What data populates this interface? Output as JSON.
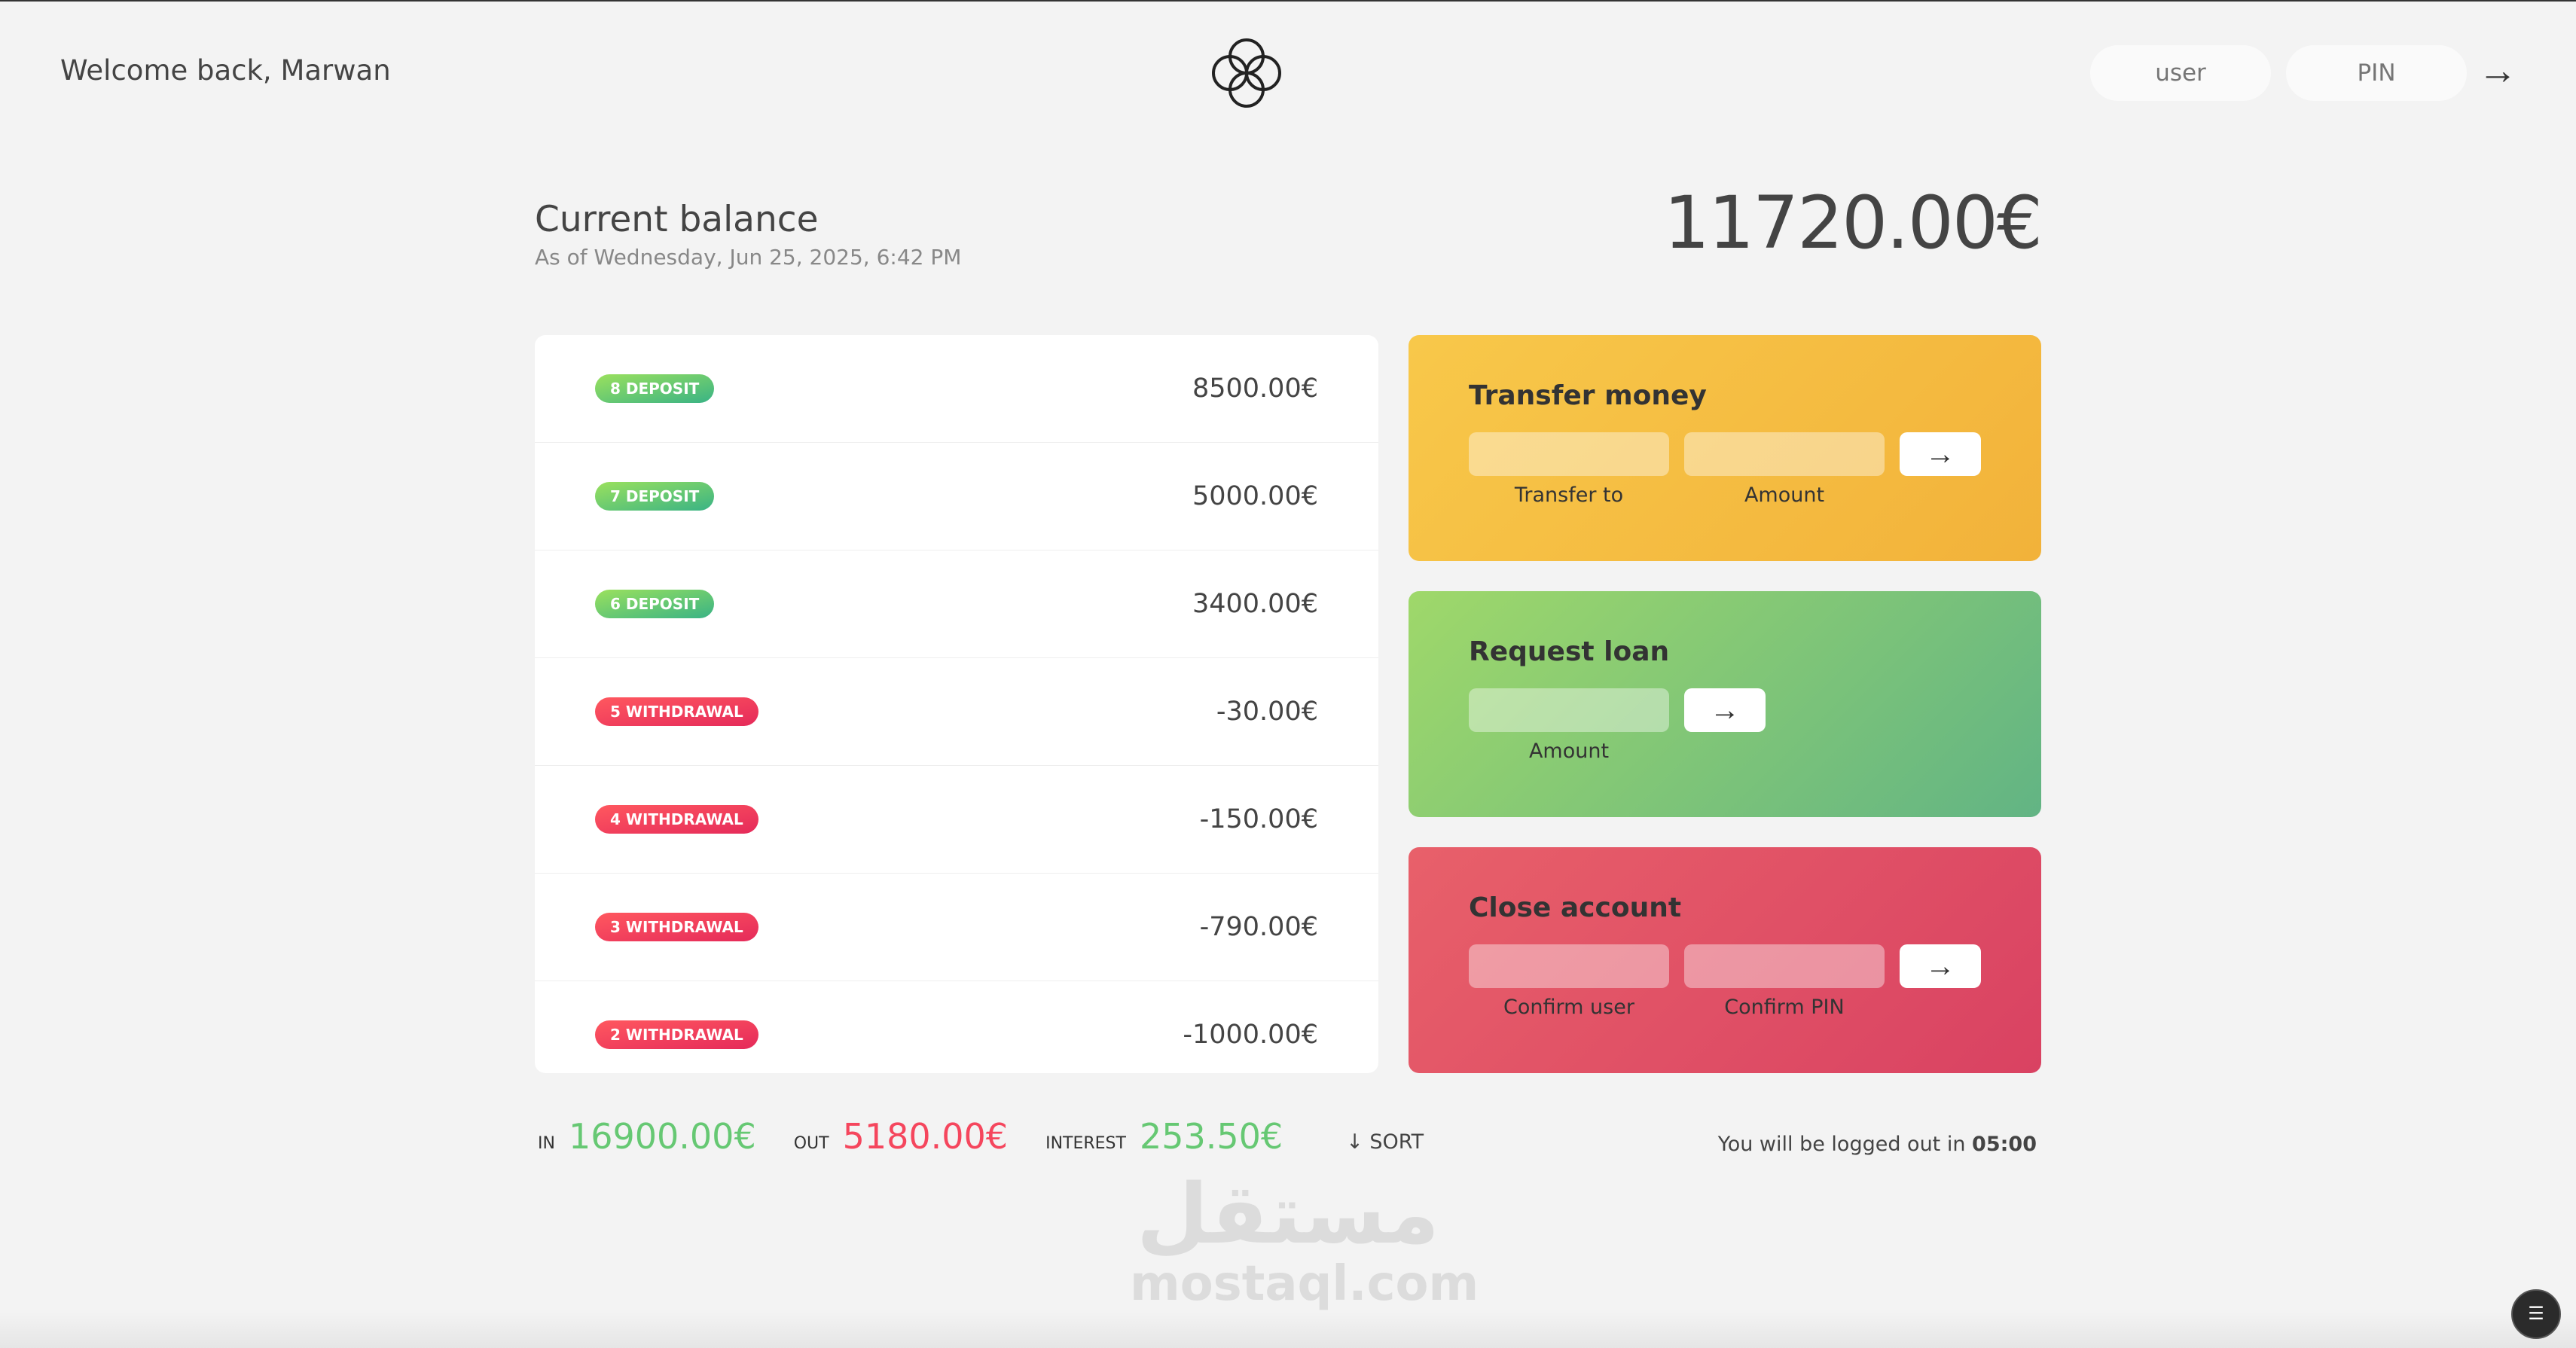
{
  "nav": {
    "welcome": "Welcome back, Marwan",
    "login_user_placeholder": "user",
    "login_pin_placeholder": "PIN",
    "login_button": "→"
  },
  "balance": {
    "label": "Current balance",
    "date": "As of Wednesday, Jun 25, 2025, 6:42 PM",
    "value": "11720.00€"
  },
  "movements": [
    {
      "type_label": "8 deposit",
      "kind": "deposit",
      "value": "8500.00€"
    },
    {
      "type_label": "7 deposit",
      "kind": "deposit",
      "value": "5000.00€"
    },
    {
      "type_label": "6 deposit",
      "kind": "deposit",
      "value": "3400.00€"
    },
    {
      "type_label": "5 withdrawal",
      "kind": "withdrawal",
      "value": "-30.00€"
    },
    {
      "type_label": "4 withdrawal",
      "kind": "withdrawal",
      "value": "-150.00€"
    },
    {
      "type_label": "3 withdrawal",
      "kind": "withdrawal",
      "value": "-790.00€"
    },
    {
      "type_label": "2 withdrawal",
      "kind": "withdrawal",
      "value": "-1000.00€"
    }
  ],
  "operations": {
    "transfer": {
      "title": "Transfer money",
      "label_to": "Transfer to",
      "label_amount": "Amount",
      "button": "→"
    },
    "loan": {
      "title": "Request loan",
      "label_amount": "Amount",
      "button": "→"
    },
    "close": {
      "title": "Close account",
      "label_user": "Confirm user",
      "label_pin": "Confirm PIN",
      "button": "→"
    }
  },
  "summary": {
    "in_label": "In",
    "in_value": "16900.00€",
    "out_label": "Out",
    "out_value": "5180.00€",
    "interest_label": "Interest",
    "interest_value": "253.50€",
    "sort_label": "↓ SORT"
  },
  "logout": {
    "text": "You will be logged out in ",
    "time": "05:00"
  },
  "watermark": {
    "arabic": "مستقل",
    "latin": "mostaql.com"
  },
  "colors": {
    "deposit": "#66c873",
    "withdrawal": "#f5465d",
    "transfer": "#f5bd3f",
    "loan": "#7fc776",
    "close": "#e04f64"
  }
}
